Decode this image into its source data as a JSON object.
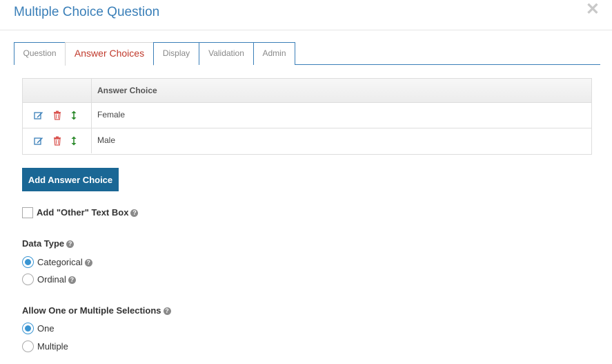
{
  "dialog": {
    "title": "Multiple Choice Question",
    "close_glyph": "✕"
  },
  "tabs": [
    {
      "label": "Question",
      "active": false
    },
    {
      "label": "Answer Choices",
      "active": true
    },
    {
      "label": "Display",
      "active": false
    },
    {
      "label": "Validation",
      "active": false
    },
    {
      "label": "Admin",
      "active": false
    }
  ],
  "answer_table": {
    "column_header": "Answer Choice",
    "rows": [
      {
        "label": "Female"
      },
      {
        "label": "Male"
      }
    ],
    "icons": [
      "edit-icon",
      "trash-icon",
      "move-icon"
    ]
  },
  "add_button": {
    "label": "Add Answer Choice"
  },
  "other_textbox": {
    "label": "Add \"Other\" Text Box",
    "checked": false
  },
  "data_type": {
    "label": "Data Type",
    "options": [
      {
        "label": "Categorical",
        "selected": true
      },
      {
        "label": "Ordinal",
        "selected": false
      }
    ]
  },
  "selection_mode": {
    "label": "Allow One or Multiple Selections",
    "options": [
      {
        "label": "One",
        "selected": true
      },
      {
        "label": "Multiple",
        "selected": false
      }
    ]
  },
  "help_glyph": "?",
  "colors": {
    "accent": "#3a7fb8",
    "active_tab_text": "#c0392b",
    "button_bg": "#1a6795",
    "radio_on": "#3a95d2",
    "edit_icon": "#3a7fb8",
    "trash_icon": "#d9534f",
    "move_icon": "#2e8b2e"
  }
}
